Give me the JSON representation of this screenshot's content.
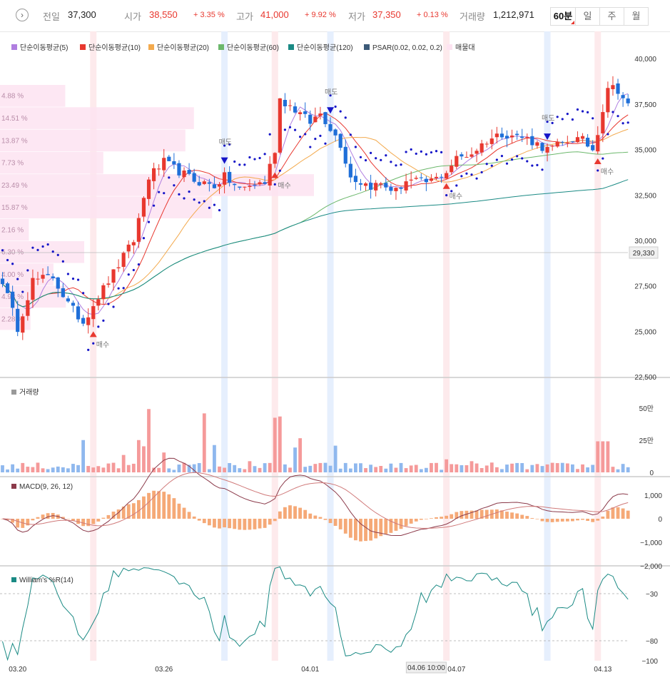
{
  "header": {
    "prev_label": "전일",
    "prev_value": "37,300",
    "open_label": "시가",
    "open_value": "38,550",
    "open_pct": "+ 3.35 %",
    "high_label": "고가",
    "high_value": "41,000",
    "high_pct": "+ 9.92 %",
    "low_label": "저가",
    "low_value": "37,350",
    "low_pct": "+ 0.13 %",
    "volume_label": "거래량",
    "volume_value": "1,212,971",
    "periods": [
      "60분",
      "일",
      "주",
      "월"
    ],
    "active_period": "60분"
  },
  "legend": [
    {
      "label": "단순이동평균(5)",
      "color": "#b07ee0"
    },
    {
      "label": "단순이동평균(10)",
      "color": "#e8382f"
    },
    {
      "label": "단순이동평균(20)",
      "color": "#f3aa4e"
    },
    {
      "label": "단순이동평균(60)",
      "color": "#6cb86c"
    },
    {
      "label": "단순이동평균(120)",
      "color": "#1a8a84"
    },
    {
      "label": "PSAR(0.02, 0.02, 0.2)",
      "color": "#3c5a78"
    },
    {
      "label": "매물대",
      "color": "#fde3f1"
    }
  ],
  "chart_data": {
    "type": "candlestick",
    "colors": {
      "up": "#e8382f",
      "down": "#1f6fd8",
      "psar": "#1515c8",
      "volume_up": "#f59a9a",
      "volume_down": "#8fb8ee"
    },
    "price_axis": {
      "ticks": [
        "40,000",
        "37,500",
        "35,000",
        "32,500",
        "30,000",
        "27,500",
        "25,000",
        "22,500"
      ],
      "min": 22500,
      "max": 41500,
      "current": "29,330"
    },
    "x_labels": [
      {
        "text": "03.20",
        "i": 3
      },
      {
        "text": "03.26",
        "i": 32
      },
      {
        "text": "04.01",
        "i": 61
      },
      {
        "text": "04.07",
        "i": 90
      },
      {
        "text": "04.13",
        "i": 119
      }
    ],
    "crosshair": {
      "label": "04.06 10:00",
      "i": 84
    },
    "price_scale": "linear",
    "volume_panel": {
      "title": "거래량",
      "ticks": [
        "50만",
        "25만",
        "0"
      ],
      "max": 600000
    },
    "macd_panel": {
      "title": "MACD(9, 26, 12)",
      "ticks": [
        "1,000",
        "0",
        "−1,000",
        "−2,000"
      ],
      "min": -2000,
      "max": 1300
    },
    "williams_panel": {
      "title": "William's %R(14)",
      "ticks": [
        "−30",
        "−80",
        "−100"
      ],
      "min": -100,
      "max": 0
    },
    "volume_profile": [
      {
        "label": "4.88 %",
        "value": 4.88
      },
      {
        "label": "14.51 %",
        "value": 14.51
      },
      {
        "label": "13.87 %",
        "value": 13.87
      },
      {
        "label": "7.73 %",
        "value": 7.73
      },
      {
        "label": "23.49 %",
        "value": 23.49
      },
      {
        "label": "15.87 %",
        "value": 15.87
      },
      {
        "label": "2.16 %",
        "value": 2.16
      },
      {
        "label": "6.30 %",
        "value": 6.3
      },
      {
        "label": "4.00 %",
        "value": 4.0
      },
      {
        "label": "4.93 %",
        "value": 4.93
      },
      {
        "label": "2.28 %",
        "value": 2.28
      }
    ],
    "signals": [
      {
        "i": 18,
        "type": "buy",
        "label": "매수"
      },
      {
        "i": 44,
        "type": "sell",
        "label": "매도"
      },
      {
        "i": 54,
        "type": "buy",
        "label": "매수"
      },
      {
        "i": 65,
        "type": "sell",
        "label": "매도"
      },
      {
        "i": 88,
        "type": "buy",
        "label": "매수"
      },
      {
        "i": 108,
        "type": "sell",
        "label": "매도"
      },
      {
        "i": 118,
        "type": "buy",
        "label": "매수"
      }
    ]
  }
}
